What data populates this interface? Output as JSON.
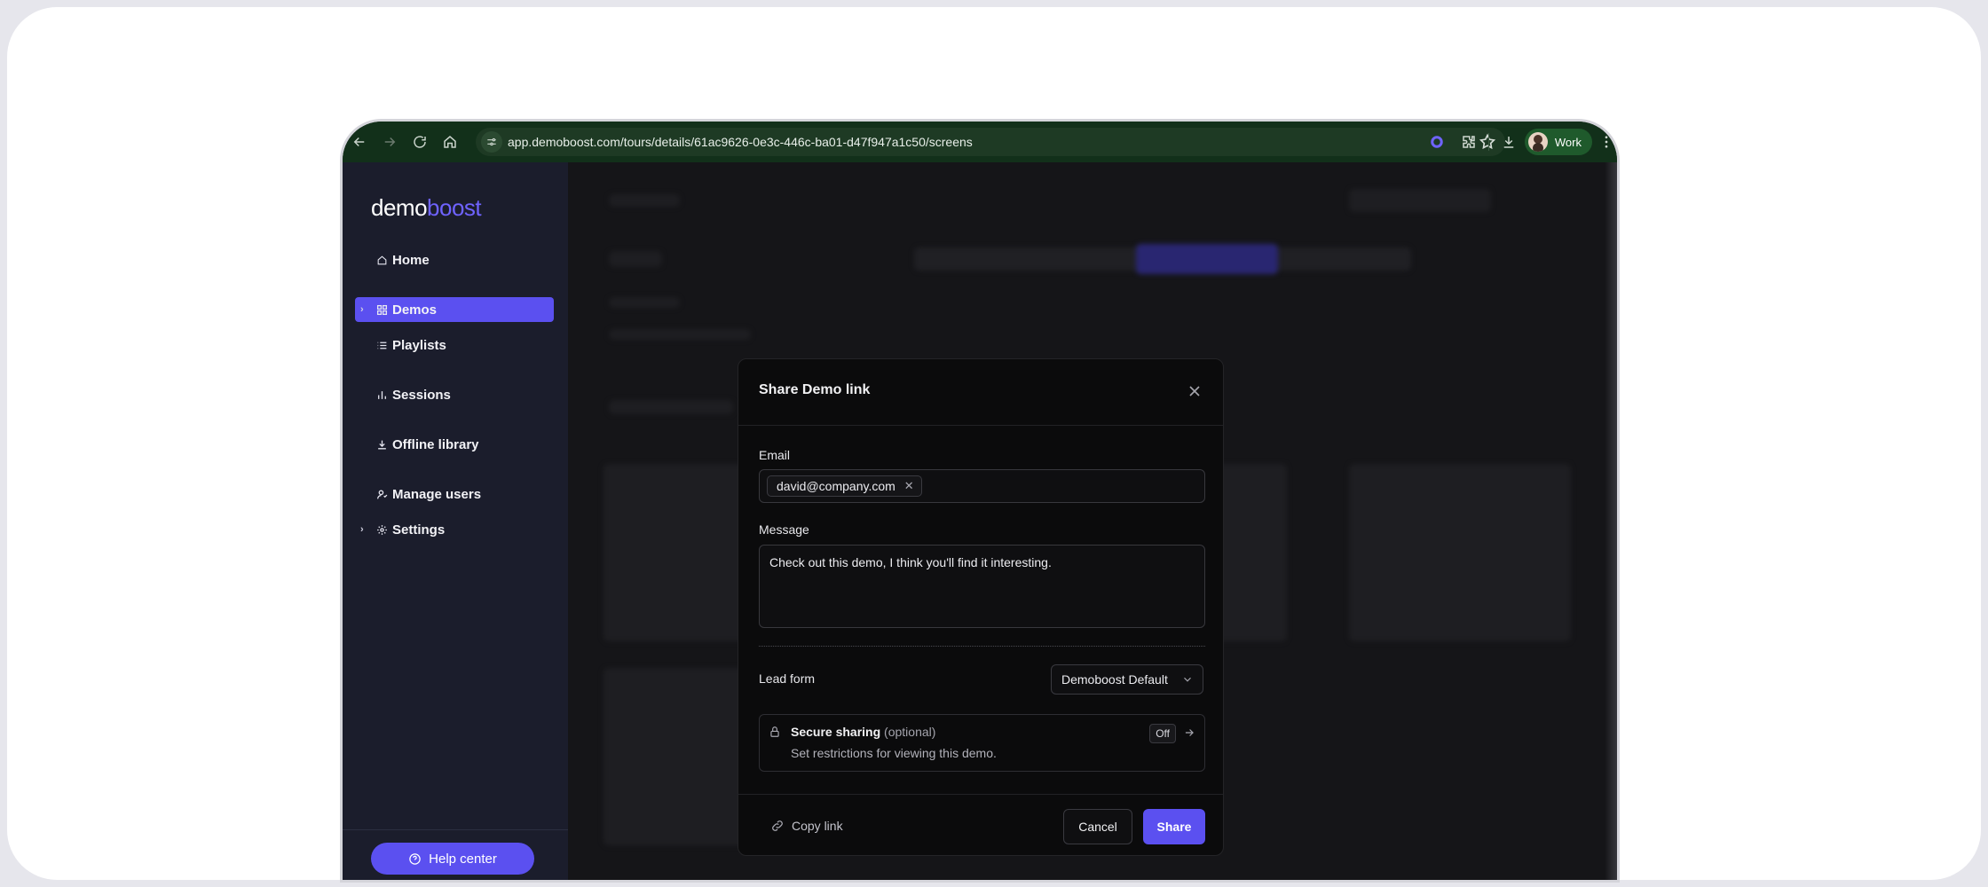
{
  "browser": {
    "url": "app.demoboost.com/tours/details/61ac9626-0e3c-446c-ba01-d47f947a1c50/screens",
    "profile_label": "Work"
  },
  "sidebar": {
    "logo_part1": "demo",
    "logo_part2": "boost",
    "items": [
      {
        "label": "Home",
        "icon": "home-icon"
      },
      {
        "label": "Demos",
        "icon": "grid-icon",
        "active": true
      },
      {
        "label": "Playlists",
        "icon": "list-icon"
      },
      {
        "label": "Sessions",
        "icon": "bar-chart-icon"
      },
      {
        "label": "Offline library",
        "icon": "download-icon"
      },
      {
        "label": "Manage users",
        "icon": "user-icon"
      },
      {
        "label": "Settings",
        "icon": "gear-icon"
      }
    ],
    "help_label": "Help center"
  },
  "modal": {
    "title": "Share Demo link",
    "email_label": "Email",
    "email_chip": "david@company.com",
    "message_label": "Message",
    "message_value": "Check out this demo, I think you'll find it interesting.",
    "lead_form_label": "Lead form",
    "lead_form_value": "Demoboost Default",
    "secure_title": "Secure sharing",
    "secure_optional": "(optional)",
    "secure_desc": "Set restrictions for viewing this demo.",
    "secure_status": "Off",
    "copy_link_label": "Copy link",
    "cancel_label": "Cancel",
    "share_label": "Share"
  },
  "colors": {
    "accent": "#5b50f0",
    "toolbar": "#12301a",
    "sidebar": "#1b1d2c"
  }
}
